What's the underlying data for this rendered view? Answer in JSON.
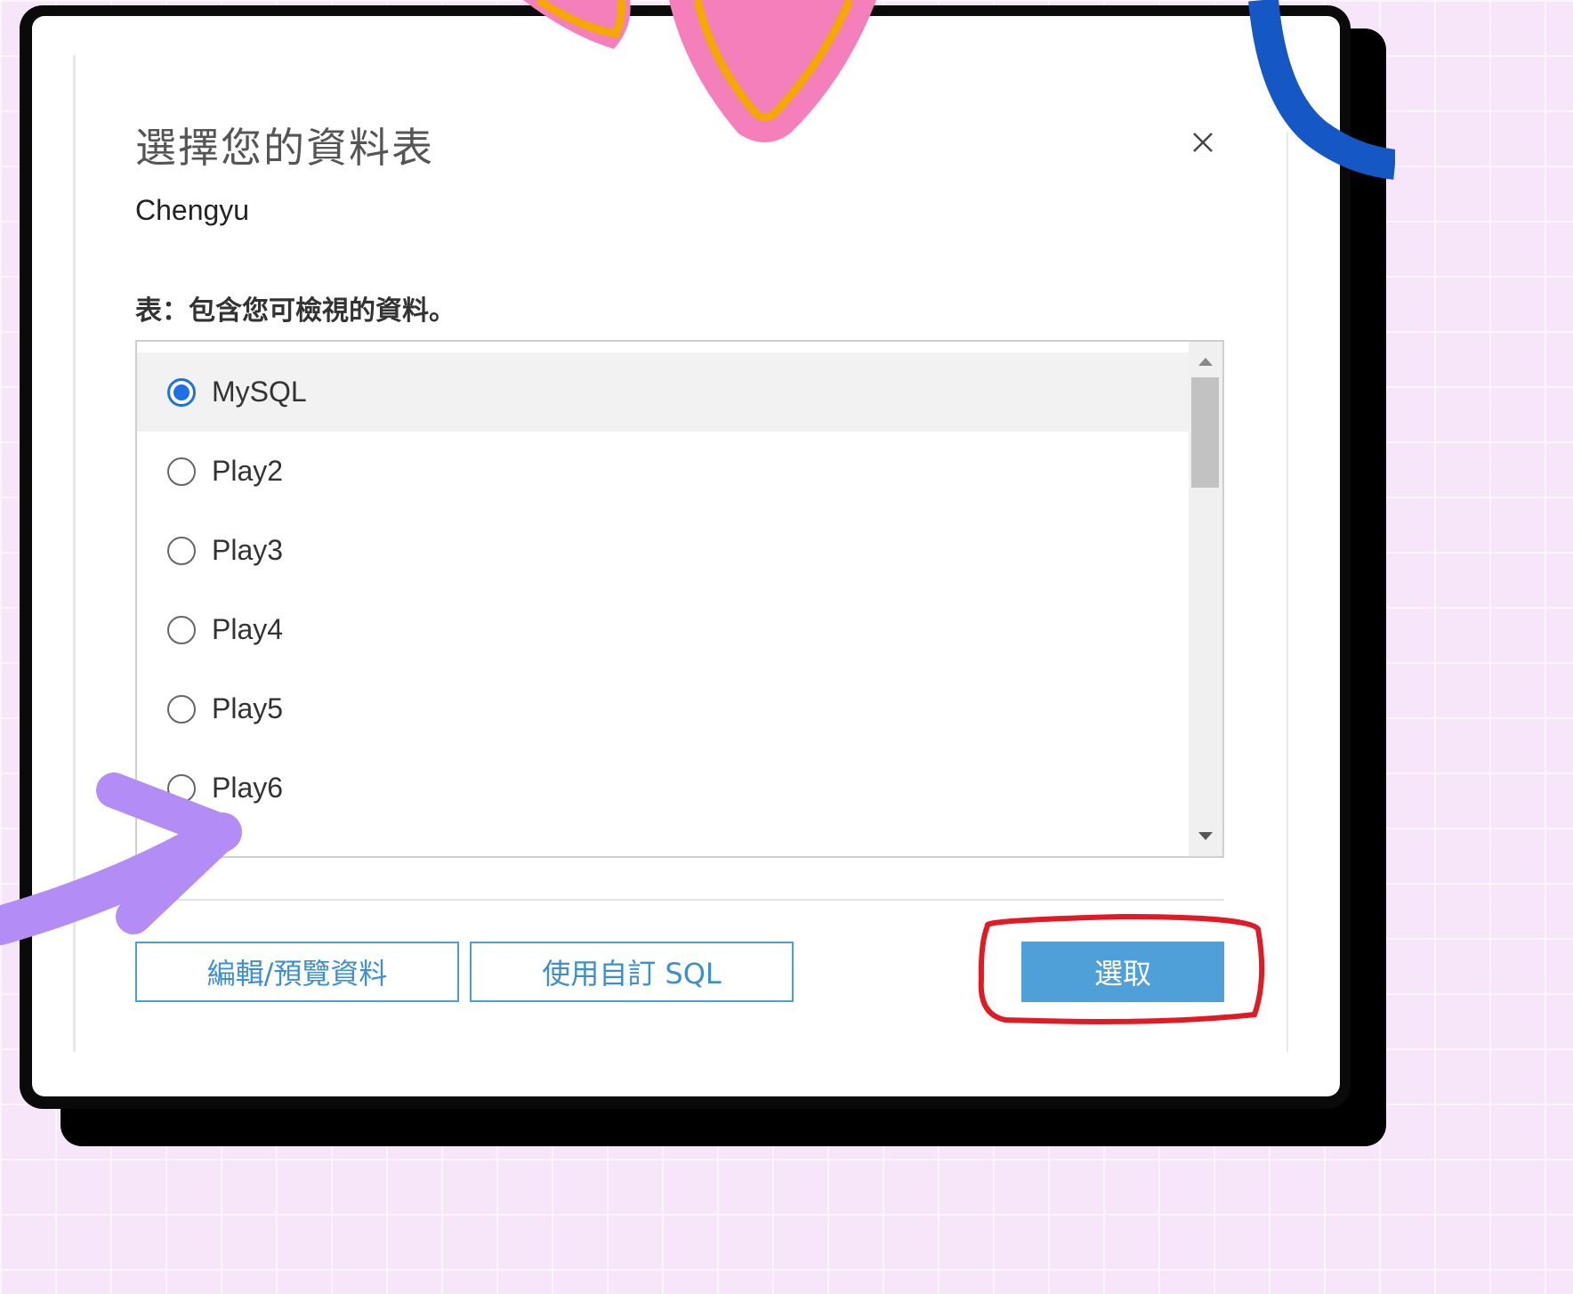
{
  "dialog": {
    "title": "選擇您的資料表",
    "connection_name": "Chengyu",
    "list_label": "表：包含您可檢視的資料。",
    "tables": [
      {
        "name": "MySQL",
        "selected": true
      },
      {
        "name": "Play2",
        "selected": false
      },
      {
        "name": "Play3",
        "selected": false
      },
      {
        "name": "Play4",
        "selected": false
      },
      {
        "name": "Play5",
        "selected": false
      },
      {
        "name": "Play6",
        "selected": false
      }
    ],
    "buttons": {
      "edit_preview": "編輯/預覽資料",
      "custom_sql": "使用自訂 SQL",
      "select": "選取"
    }
  },
  "colors": {
    "accent": "#1f6fe5",
    "primary_button": "#4f9fd8",
    "highlight_circle": "#e01b24",
    "arrow": "#b38cf5"
  },
  "icons": [
    "close-icon",
    "radio-icon",
    "scroll-up-icon",
    "scroll-down-icon",
    "arrow-annotation-icon"
  ]
}
